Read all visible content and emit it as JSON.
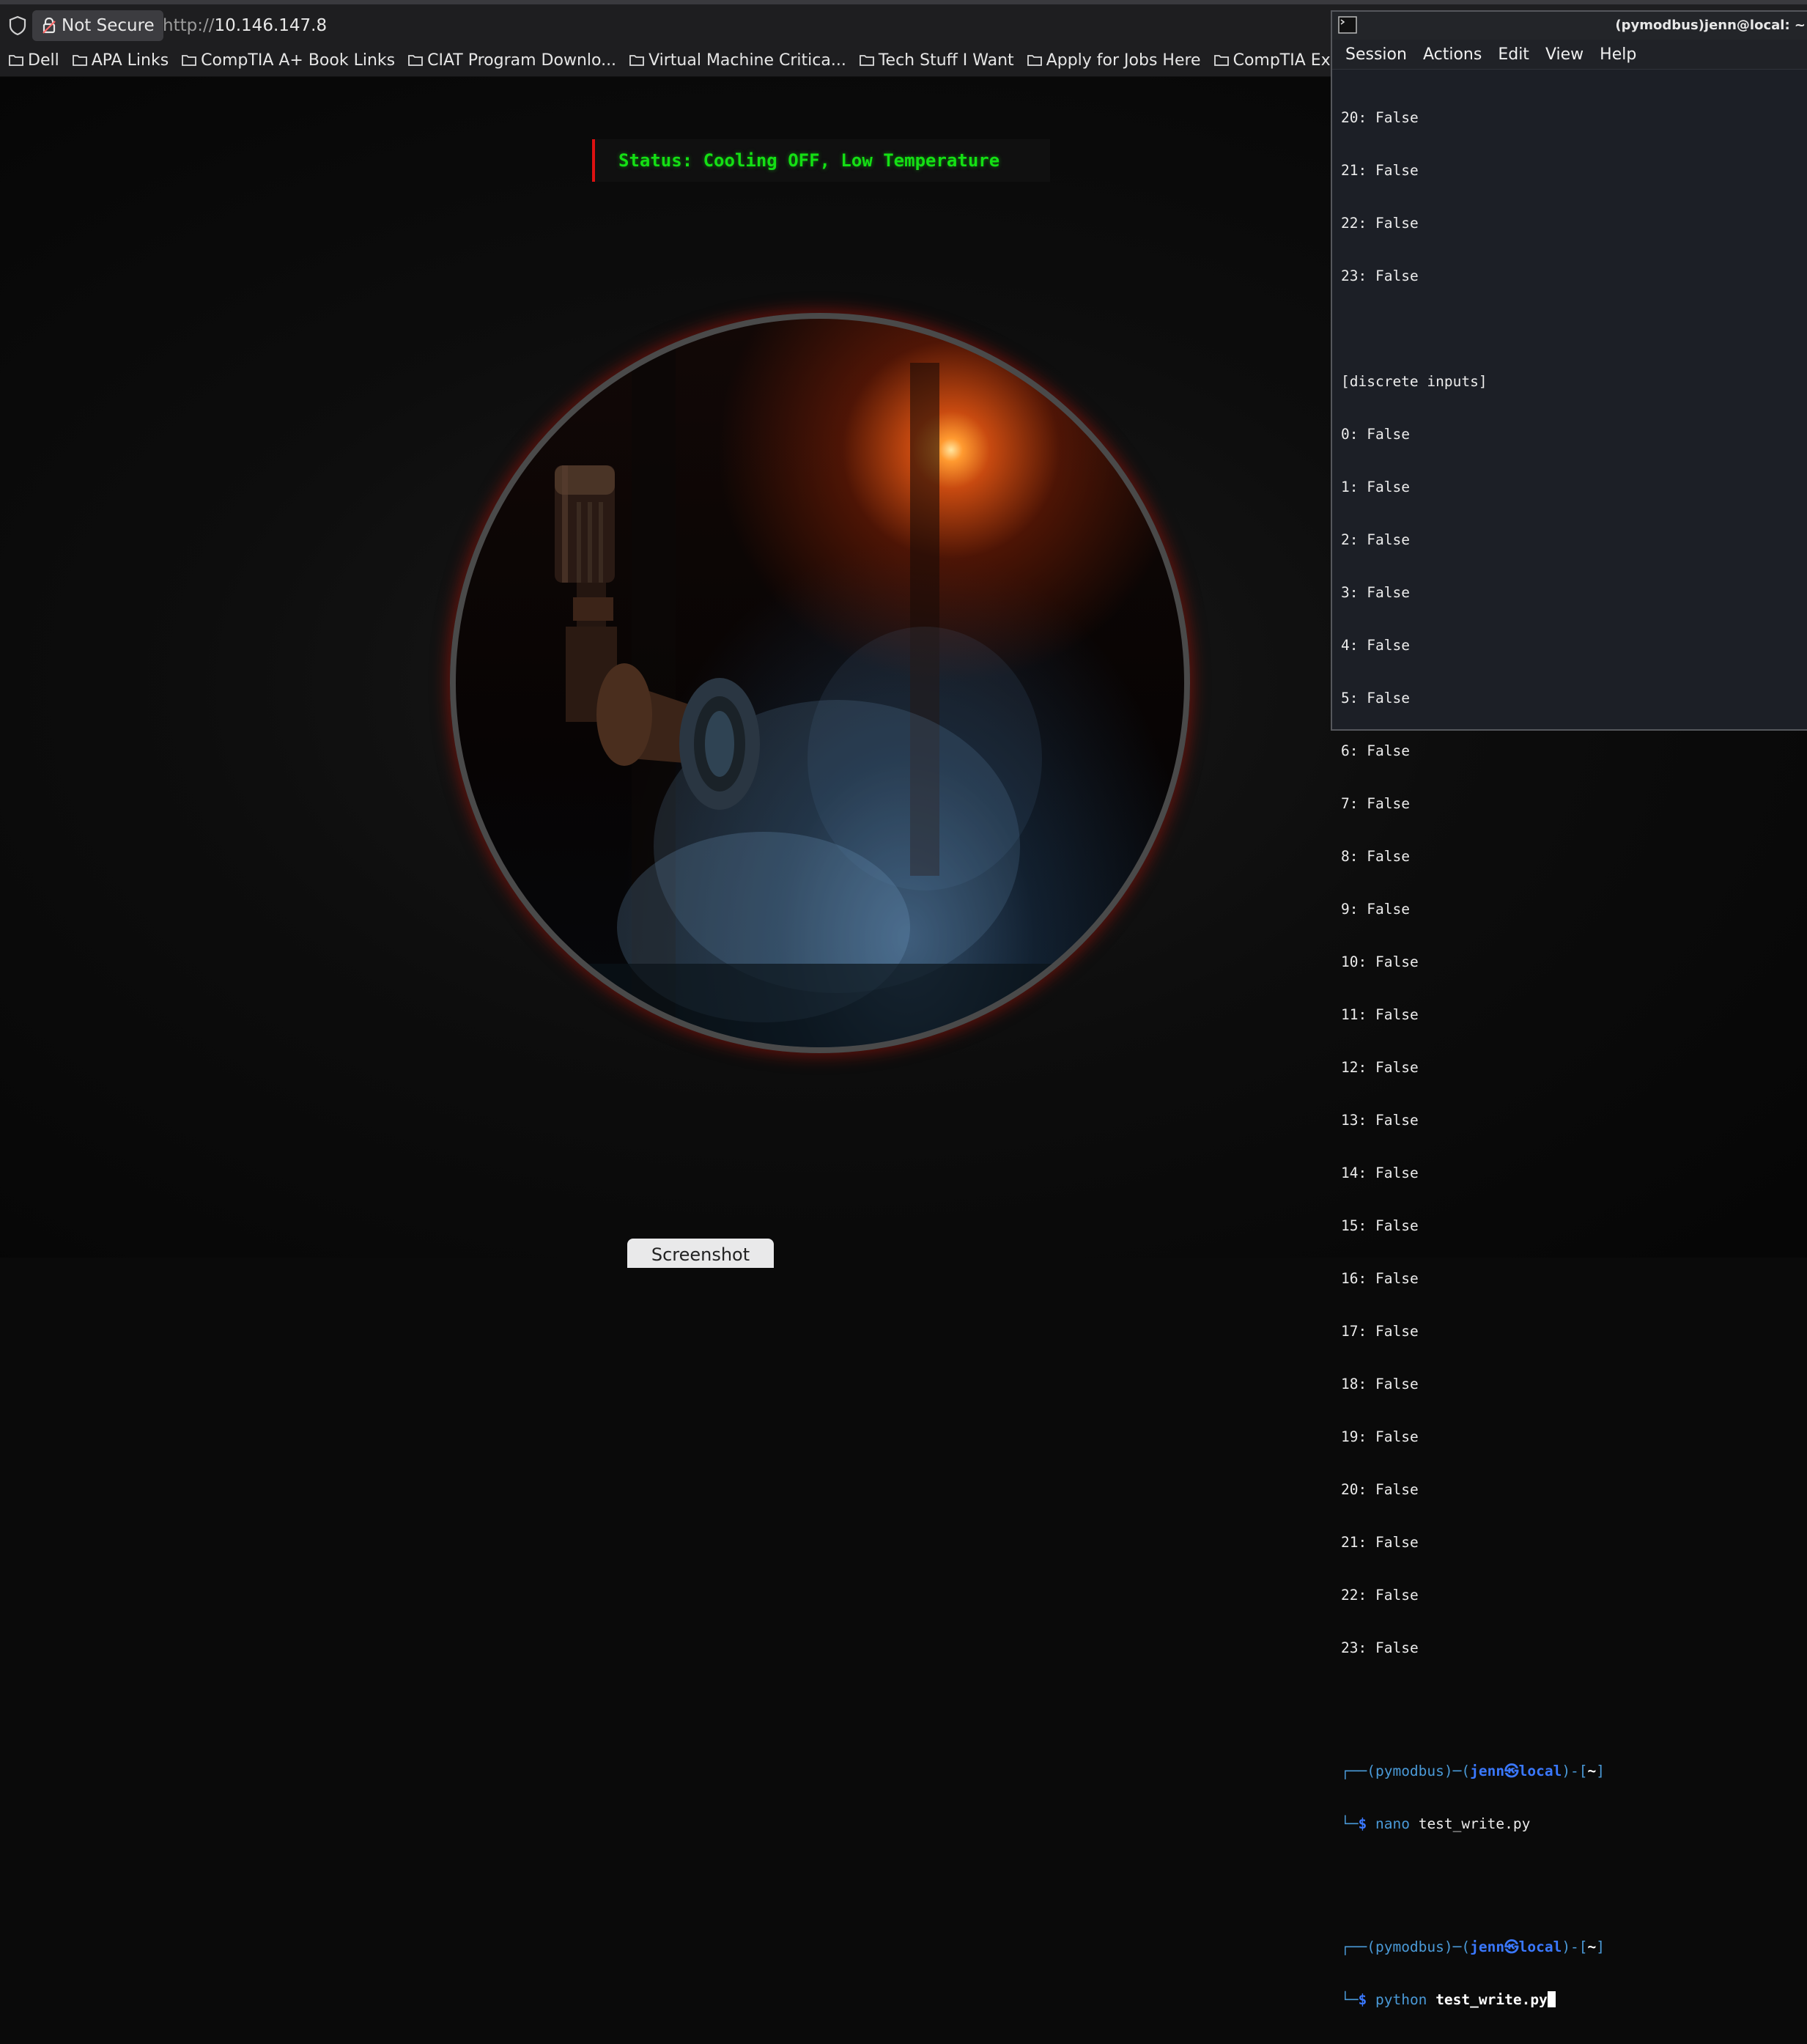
{
  "browser": {
    "security_label": "Not Secure",
    "url_scheme": "http://",
    "url_host": "10.146.147.8",
    "bookmarks": [
      {
        "label": "Dell"
      },
      {
        "label": "APA Links"
      },
      {
        "label": "CompTIA A+ Book Links"
      },
      {
        "label": "CIAT Program Downlo..."
      },
      {
        "label": "Virtual Machine Critica..."
      },
      {
        "label": "Tech Stuff I Want"
      },
      {
        "label": "Apply for Jobs Here"
      },
      {
        "label": "CompTIA Exam Links"
      }
    ]
  },
  "page": {
    "status_text": "Status: Cooling OFF, Low Temperature",
    "screenshot_button": "Screenshot",
    "colors": {
      "status_text": "#14e014",
      "status_border": "#dd1111",
      "ring_glow": "#aa140a"
    }
  },
  "terminal": {
    "title": "(pymodbus)jenn@local: ~",
    "menu": [
      "Session",
      "Actions",
      "Edit",
      "View",
      "Help"
    ],
    "coils_tail": [
      {
        "index": "20:",
        "value": "False"
      },
      {
        "index": "21:",
        "value": "False"
      },
      {
        "index": "22:",
        "value": "False"
      },
      {
        "index": "23:",
        "value": "False"
      }
    ],
    "section_header": "[discrete inputs]",
    "discrete_inputs": [
      {
        "index": "0:",
        "value": "False"
      },
      {
        "index": "1:",
        "value": "False"
      },
      {
        "index": "2:",
        "value": "False"
      },
      {
        "index": "3:",
        "value": "False"
      },
      {
        "index": "4:",
        "value": "False"
      },
      {
        "index": "5:",
        "value": "False"
      },
      {
        "index": "6:",
        "value": "False"
      },
      {
        "index": "7:",
        "value": "False"
      },
      {
        "index": "8:",
        "value": "False"
      },
      {
        "index": "9:",
        "value": "False"
      },
      {
        "index": "10:",
        "value": "False"
      },
      {
        "index": "11:",
        "value": "False"
      },
      {
        "index": "12:",
        "value": "False"
      },
      {
        "index": "13:",
        "value": "False"
      },
      {
        "index": "14:",
        "value": "False"
      },
      {
        "index": "15:",
        "value": "False"
      },
      {
        "index": "16:",
        "value": "False"
      },
      {
        "index": "17:",
        "value": "False"
      },
      {
        "index": "18:",
        "value": "False"
      },
      {
        "index": "19:",
        "value": "False"
      },
      {
        "index": "20:",
        "value": "False"
      },
      {
        "index": "21:",
        "value": "False"
      },
      {
        "index": "22:",
        "value": "False"
      },
      {
        "index": "23:",
        "value": "False"
      }
    ],
    "prompt": {
      "env": "(pymodbus)",
      "user": "jenn",
      "at": "㉿",
      "host": "local",
      "dir": "~",
      "dollar": "$"
    },
    "commands": [
      {
        "cmd": "nano",
        "arg": "test_write.py"
      },
      {
        "cmd": "python",
        "arg": "test_write.py"
      }
    ]
  }
}
